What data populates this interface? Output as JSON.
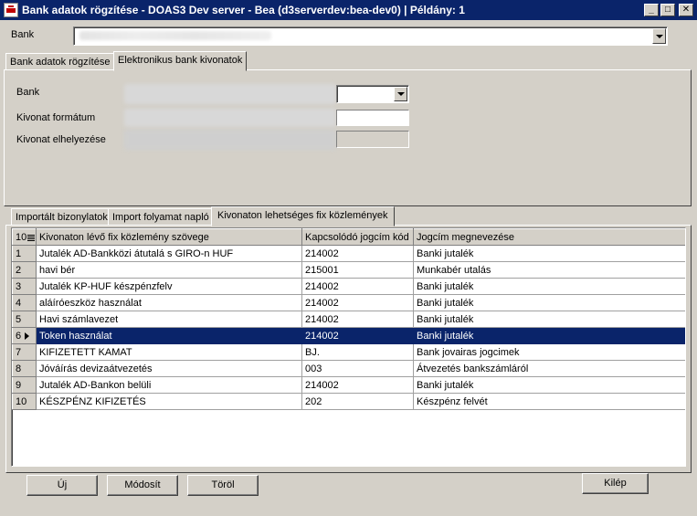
{
  "window": {
    "title": "Bank adatok rögzítése - DOAS3 Dev server - Bea (d3serverdev:bea-dev0) | Példány: 1",
    "minimize": "_",
    "maximize": "□",
    "close": "✕"
  },
  "bank_label": "Bank",
  "main_tabs": [
    {
      "label": "Bank adatok rögzítése"
    },
    {
      "label": "Elektronikus bank kivonatok"
    }
  ],
  "form": {
    "bank_label": "Bank",
    "format_label": "Kivonat formátum",
    "location_label": "Kivonat elhelyezése"
  },
  "sub_tabs": [
    {
      "label": "Importált bizonylatok"
    },
    {
      "label": "Import folyamat napló"
    },
    {
      "label": "Kivonaton lehetséges fix közlemények"
    }
  ],
  "grid": {
    "row_count": "10",
    "columns": [
      "Kivonaton lévő fix közlemény szövege",
      "Kapcsolódó jogcím kód",
      "Jogcím megnevezése"
    ],
    "rows": [
      {
        "n": "1",
        "text": "Jutalék AD-Bankközi átutalá s GIRO-n HUF",
        "code": "214002",
        "name": "Banki jutalék"
      },
      {
        "n": "2",
        "text": "havi bér",
        "code": "215001",
        "name": "Munkabér utalás"
      },
      {
        "n": "3",
        "text": "Jutalék KP-HUF készpénzfelv",
        "code": "214002",
        "name": "Banki jutalék"
      },
      {
        "n": "4",
        "text": "aláíróeszköz használat",
        "code": "214002",
        "name": "Banki jutalék"
      },
      {
        "n": "5",
        "text": "Havi számlavezet",
        "code": "214002",
        "name": "Banki jutalék"
      },
      {
        "n": "6",
        "text": "Token használat",
        "code": "214002",
        "name": "Banki jutalék"
      },
      {
        "n": "7",
        "text": "KIFIZETETT KAMAT",
        "code": "BJ.",
        "name": "Bank jovairas jogcimek"
      },
      {
        "n": "8",
        "text": "Jóváírás devizaátvezetés",
        "code": "003",
        "name": "Átvezetés bankszámláról"
      },
      {
        "n": "9",
        "text": "Jutalék AD-Bankon belüli",
        "code": "214002",
        "name": "Banki jutalék"
      },
      {
        "n": "10",
        "text": "KÉSZPÉNZ KIFIZETÉS",
        "code": "202",
        "name": "Készpénz felvét"
      }
    ]
  },
  "buttons": {
    "new": "Új",
    "edit": "Módosít",
    "delete": "Töröl",
    "exit": "Kilép"
  },
  "colors": {
    "title_bar": "#0a246a",
    "selection": "#0a246a",
    "face": "#d4d0c8"
  }
}
